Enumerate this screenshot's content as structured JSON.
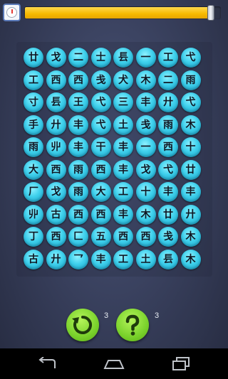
{
  "header": {
    "timer_icon": "clock-icon",
    "progress_fraction": 0.965
  },
  "colors": {
    "tile": "#3ed0ec",
    "progress": "#f6b900",
    "action_button": "#79d12b"
  },
  "board": {
    "rows": [
      [
        "廿",
        "戈",
        "二",
        "士",
        "镸",
        "一",
        "工",
        "弋"
      ],
      [
        "工",
        "西",
        "西",
        "戋",
        "犬",
        "木",
        "二",
        "雨"
      ],
      [
        "寸",
        "镸",
        "王",
        "弋",
        "三",
        "丰",
        "廾",
        "弋"
      ],
      [
        "手",
        "廾",
        "丰",
        "弋",
        "土",
        "戋",
        "雨",
        "木"
      ],
      [
        "雨",
        "丱",
        "丰",
        "干",
        "丰",
        "一",
        "西",
        "十"
      ],
      [
        "大",
        "西",
        "雨",
        "西",
        "丰",
        "戈",
        "弋",
        "廿"
      ],
      [
        "厂",
        "戈",
        "雨",
        "大",
        "工",
        "十",
        "丰",
        "丰"
      ],
      [
        "丱",
        "古",
        "西",
        "西",
        "丰",
        "木",
        "廿",
        "廾"
      ],
      [
        "丁",
        "西",
        "匚",
        "五",
        "西",
        "西",
        "戋",
        "木"
      ],
      [
        "古",
        "廾",
        "乛",
        "丰",
        "工",
        "土",
        "镸",
        "木"
      ]
    ]
  },
  "actions": {
    "shuffle": {
      "icon": "refresh-icon",
      "count": "3"
    },
    "hint": {
      "icon": "question-icon",
      "count": "3"
    }
  },
  "system_nav": {
    "back_icon": "back-icon",
    "home_icon": "home-icon",
    "recents_icon": "recents-icon"
  }
}
